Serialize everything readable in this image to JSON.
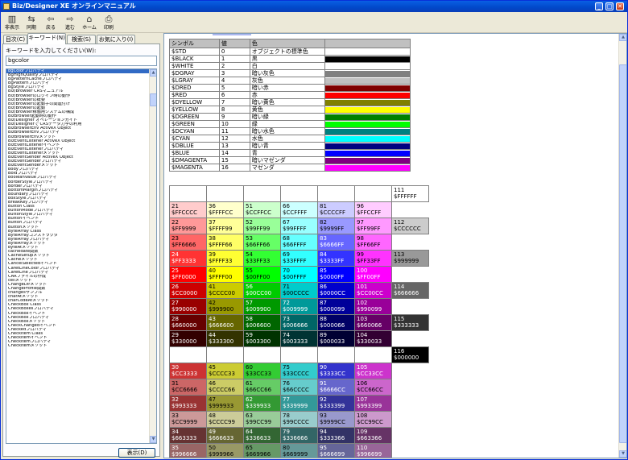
{
  "window": {
    "title": "Biz/Designer XE オンラインマニュアル",
    "min": "_",
    "max": "□",
    "close": "✕"
  },
  "toolbar": [
    {
      "label": "非表示",
      "icon": "hide-icon"
    },
    {
      "label": "同期",
      "icon": "sync-icon"
    },
    {
      "label": "戻る",
      "icon": "back-arrow-icon"
    },
    {
      "label": "進む",
      "icon": "forward-arrow-icon"
    },
    {
      "label": "ホーム",
      "icon": "home-icon"
    },
    {
      "label": "印刷",
      "icon": "print-icon"
    }
  ],
  "tabs": [
    "目次(C)",
    "キーワード(N)",
    "検索(S)",
    "お気に入り(I)"
  ],
  "keyword": {
    "label": "キーワードを入力してください(W):",
    "value": "bgcolor",
    "show_button": "表示(D)"
  },
  "keywords": [
    "bgColorプロパティ",
    "BgHighQualityプロパティ",
    "BgPatternCacheプロパティ",
    "BgPatternプロパティ",
    "BgStyleプロパティ",
    "Biz/Browser CRSマニュアル",
    "Biz/Browserのログイン時の動作",
    "Biz/Browserの概要",
    "Biz/Browserの起動子の関連付け",
    "Biz/Browserの起動",
    "Biz/Browser稼働用システムの構成",
    "BizBrowser起動時の動作",
    "Biz/Designer オペレーションガイド",
    "Biz/Designerで CRSデータ力学の利用",
    "BizBrowserEnv ActiveX Object",
    "BizBrowserEnvプロパティ",
    "BizBrowserEnvメソッド",
    "BizEventListener ActiveX Object",
    "BizEventListenerイベント",
    "BizEventListenerプロパティ",
    "BizEventListenerメソッド",
    "BizEventSender ActiveX Object",
    "BizEventSenderプロパティ",
    "BizEventSenderメソッド",
    "bodyプロパティ",
    "Boldプロパティ",
    "booleanValueプロパティ",
    "borderStyleプロパティ",
    "Borderプロパティ",
    "BottomMarginプロパティ",
    "Boundaryプロパティ",
    "boxStyleプロパティ",
    "BreakKeyプロパティ",
    "Button Class",
    "buttonModeプロパティ",
    "buttonStyleプロパティ",
    "Buttonイベント",
    "Buttonプロパティ",
    "Buttonメソッド",
    "ByteArray Class",
    "ByteArrayコンストラクタ",
    "ByteArrayプロパティ",
    "ByteArrayメソッド",
    "byteAtメソッド",
    "cachedate関数",
    "CacheSetupメソッド",
    "Cacheメソッド",
    "CancelSelectedイベント",
    "CaretLineColorプロパティ",
    "CaretLineプロパティ",
    "CARファイルの作成",
    "ceilメソッド",
    "ChangeDirメソッド",
    "ChangeProfile関数",
    "changesサンプル",
    "charAtメソッド",
    "charCodeAtメソッド",
    "CheckBox Class",
    "CheckBoxesプロパティ",
    "CheckBoxイベント",
    "CheckBoxプロパティ",
    "CheckBoxメソッド",
    "CheckChangedイベント",
    "Checkedプロパティ",
    "CheckItem Class",
    "CheckItemイベント",
    "CheckItemプロパティ",
    "CheckItemメソッド"
  ],
  "colors": {
    "headers": [
      "シンボル",
      "値",
      "色"
    ],
    "rows": [
      {
        "sym": "$STD",
        "val": "0",
        "name": "オブジェクトの標準色",
        "hex": ""
      },
      {
        "sym": "$BLACK",
        "val": "1",
        "name": "黒",
        "hex": "#000000"
      },
      {
        "sym": "$WHITE",
        "val": "2",
        "name": "白",
        "hex": "#ffffff"
      },
      {
        "sym": "$DGRAY",
        "val": "3",
        "name": "暗い灰色",
        "hex": "#808080"
      },
      {
        "sym": "$LGRAY",
        "val": "4",
        "name": "灰色",
        "hex": "#c0c0c0"
      },
      {
        "sym": "$DRED",
        "val": "5",
        "name": "暗い赤",
        "hex": "#800000"
      },
      {
        "sym": "$RED",
        "val": "6",
        "name": "赤",
        "hex": "#ff0000"
      },
      {
        "sym": "$DYELLOW",
        "val": "7",
        "name": "暗い黄色",
        "hex": "#808000"
      },
      {
        "sym": "$YELLOW",
        "val": "8",
        "name": "黄色",
        "hex": "#ffff00"
      },
      {
        "sym": "$DGREEN",
        "val": "9",
        "name": "暗い緑",
        "hex": "#008000"
      },
      {
        "sym": "$GREEN",
        "val": "10",
        "name": "緑",
        "hex": "#00ff00"
      },
      {
        "sym": "$DCYAN",
        "val": "11",
        "name": "暗い水色",
        "hex": "#008080"
      },
      {
        "sym": "$CYAN",
        "val": "12",
        "name": "水色",
        "hex": "#00ffff"
      },
      {
        "sym": "$DBLUE",
        "val": "13",
        "name": "暗い青",
        "hex": "#000080"
      },
      {
        "sym": "$BLUE",
        "val": "14",
        "name": "青",
        "hex": "#0000ff"
      },
      {
        "sym": "$DMAGENTA",
        "val": "15",
        "name": "暗いマゼンダ",
        "hex": "#800080"
      },
      {
        "sym": "$MAGENTA",
        "val": "16",
        "name": "マゼンダ",
        "hex": "#ff00ff"
      }
    ]
  },
  "palette": [
    [
      {
        "n": "",
        "c": "",
        "bg": ""
      },
      {
        "n": "",
        "c": "",
        "bg": ""
      },
      {
        "n": "",
        "c": "",
        "bg": ""
      },
      {
        "n": "",
        "c": "",
        "bg": ""
      },
      {
        "n": "",
        "c": "",
        "bg": ""
      },
      {
        "n": "",
        "c": "",
        "bg": ""
      },
      {
        "n": "111",
        "c": "$FFFFFF",
        "bg": "#ffffff"
      }
    ],
    [
      {
        "n": "21",
        "c": "$FFCCCC",
        "bg": "#ffcccc"
      },
      {
        "n": "36",
        "c": "$FFFFCC",
        "bg": "#ffffcc"
      },
      {
        "n": "51",
        "c": "$CCFFCC",
        "bg": "#ccffcc"
      },
      {
        "n": "66",
        "c": "$CCFFFF",
        "bg": "#ccffff"
      },
      {
        "n": "81",
        "c": "$CCCCFF",
        "bg": "#ccccff"
      },
      {
        "n": "96",
        "c": "$FFCCFF",
        "bg": "#ffccff"
      },
      {
        "n": "",
        "c": "",
        "bg": ""
      }
    ],
    [
      {
        "n": "22",
        "c": "$FF9999",
        "bg": "#ff9999"
      },
      {
        "n": "37",
        "c": "$FFFF99",
        "bg": "#ffff99"
      },
      {
        "n": "52",
        "c": "$99FF99",
        "bg": "#99ff99"
      },
      {
        "n": "67",
        "c": "$99FFFF",
        "bg": "#99ffff"
      },
      {
        "n": "82",
        "c": "$9999FF",
        "bg": "#9999ff"
      },
      {
        "n": "97",
        "c": "$FF99FF",
        "bg": "#ff99ff"
      },
      {
        "n": "112",
        "c": "$CCCCCC",
        "bg": "#cccccc"
      }
    ],
    [
      {
        "n": "23",
        "c": "$FF6666",
        "bg": "#ff6666"
      },
      {
        "n": "38",
        "c": "$FFFF66",
        "bg": "#ffff66"
      },
      {
        "n": "53",
        "c": "$66FF66",
        "bg": "#66ff66"
      },
      {
        "n": "68",
        "c": "$66FFFF",
        "bg": "#66ffff"
      },
      {
        "n": "83",
        "c": "$6666FF",
        "bg": "#6666ff"
      },
      {
        "n": "98",
        "c": "$FF66FF",
        "bg": "#ff66ff"
      },
      {
        "n": "",
        "c": "",
        "bg": ""
      }
    ],
    [
      {
        "n": "24",
        "c": "$FF3333",
        "bg": "#ff3333"
      },
      {
        "n": "39",
        "c": "$FFFF33",
        "bg": "#ffff33"
      },
      {
        "n": "54",
        "c": "$33FF33",
        "bg": "#33ff33"
      },
      {
        "n": "69",
        "c": "$33FFFF",
        "bg": "#33ffff"
      },
      {
        "n": "84",
        "c": "$3333FF",
        "bg": "#3333ff"
      },
      {
        "n": "99",
        "c": "$FF33FF",
        "bg": "#ff33ff"
      },
      {
        "n": "113",
        "c": "$999999",
        "bg": "#999999"
      }
    ],
    [
      {
        "n": "25",
        "c": "$FF0000",
        "bg": "#ff0000"
      },
      {
        "n": "40",
        "c": "$FFFF00",
        "bg": "#ffff00"
      },
      {
        "n": "55",
        "c": "$00FF00",
        "bg": "#00ff00"
      },
      {
        "n": "70",
        "c": "$00FFFF",
        "bg": "#00ffff"
      },
      {
        "n": "85",
        "c": "$0000FF",
        "bg": "#0000ff"
      },
      {
        "n": "100",
        "c": "$FF00FF",
        "bg": "#ff00ff"
      },
      {
        "n": "",
        "c": "",
        "bg": ""
      }
    ],
    [
      {
        "n": "26",
        "c": "$CC0000",
        "bg": "#cc0000"
      },
      {
        "n": "41",
        "c": "$CCCC00",
        "bg": "#cccc00"
      },
      {
        "n": "56",
        "c": "$00CC00",
        "bg": "#00cc00"
      },
      {
        "n": "71",
        "c": "$00CCCC",
        "bg": "#00cccc"
      },
      {
        "n": "86",
        "c": "$0000CC",
        "bg": "#0000cc"
      },
      {
        "n": "101",
        "c": "$CC00CC",
        "bg": "#cc00cc"
      },
      {
        "n": "114",
        "c": "$666666",
        "bg": "#666666"
      }
    ],
    [
      {
        "n": "27",
        "c": "$990000",
        "bg": "#990000"
      },
      {
        "n": "42",
        "c": "$999900",
        "bg": "#999900"
      },
      {
        "n": "57",
        "c": "$009900",
        "bg": "#009900"
      },
      {
        "n": "72",
        "c": "$009999",
        "bg": "#009999"
      },
      {
        "n": "87",
        "c": "$000099",
        "bg": "#000099"
      },
      {
        "n": "102",
        "c": "$990099",
        "bg": "#990099"
      },
      {
        "n": "",
        "c": "",
        "bg": ""
      }
    ],
    [
      {
        "n": "28",
        "c": "$660000",
        "bg": "#660000"
      },
      {
        "n": "43",
        "c": "$666600",
        "bg": "#666600"
      },
      {
        "n": "58",
        "c": "$006600",
        "bg": "#006600"
      },
      {
        "n": "73",
        "c": "$006666",
        "bg": "#006666"
      },
      {
        "n": "88",
        "c": "$000066",
        "bg": "#000066"
      },
      {
        "n": "103",
        "c": "$660066",
        "bg": "#660066"
      },
      {
        "n": "115",
        "c": "$333333",
        "bg": "#333333"
      }
    ],
    [
      {
        "n": "29",
        "c": "$330000",
        "bg": "#330000"
      },
      {
        "n": "44",
        "c": "$333300",
        "bg": "#333300"
      },
      {
        "n": "59",
        "c": "$003300",
        "bg": "#003300"
      },
      {
        "n": "74",
        "c": "$003333",
        "bg": "#003333"
      },
      {
        "n": "89",
        "c": "$000033",
        "bg": "#000033"
      },
      {
        "n": "104",
        "c": "$330033",
        "bg": "#330033"
      },
      {
        "n": "",
        "c": "",
        "bg": ""
      }
    ],
    [
      {
        "n": "",
        "c": "",
        "bg": ""
      },
      {
        "n": "",
        "c": "",
        "bg": ""
      },
      {
        "n": "",
        "c": "",
        "bg": ""
      },
      {
        "n": "",
        "c": "",
        "bg": ""
      },
      {
        "n": "",
        "c": "",
        "bg": ""
      },
      {
        "n": "",
        "c": "",
        "bg": ""
      },
      {
        "n": "116",
        "c": "$000000",
        "bg": "#000000"
      }
    ],
    [
      {
        "n": "30",
        "c": "$CC3333",
        "bg": "#cc3333"
      },
      {
        "n": "45",
        "c": "$CCCC33",
        "bg": "#cccc33"
      },
      {
        "n": "60",
        "c": "$33CC33",
        "bg": "#33cc33"
      },
      {
        "n": "75",
        "c": "$33CCCC",
        "bg": "#33cccc"
      },
      {
        "n": "90",
        "c": "$3333CC",
        "bg": "#3333cc"
      },
      {
        "n": "105",
        "c": "$CC33CC",
        "bg": "#cc33cc"
      },
      {
        "n": "",
        "c": "",
        "bg": ""
      }
    ],
    [
      {
        "n": "31",
        "c": "$CC6666",
        "bg": "#cc6666"
      },
      {
        "n": "46",
        "c": "$CCCC66",
        "bg": "#cccc66"
      },
      {
        "n": "61",
        "c": "$66CC66",
        "bg": "#66cc66"
      },
      {
        "n": "76",
        "c": "$66CCCC",
        "bg": "#66cccc"
      },
      {
        "n": "91",
        "c": "$6666CC",
        "bg": "#6666cc"
      },
      {
        "n": "106",
        "c": "$CC66CC",
        "bg": "#cc66cc"
      },
      {
        "n": "",
        "c": "",
        "bg": ""
      }
    ],
    [
      {
        "n": "32",
        "c": "$993333",
        "bg": "#993333"
      },
      {
        "n": "47",
        "c": "$999933",
        "bg": "#999933"
      },
      {
        "n": "62",
        "c": "$339933",
        "bg": "#339933"
      },
      {
        "n": "77",
        "c": "$339999",
        "bg": "#339999"
      },
      {
        "n": "92",
        "c": "$333399",
        "bg": "#333399"
      },
      {
        "n": "107",
        "c": "$993399",
        "bg": "#993399"
      },
      {
        "n": "",
        "c": "",
        "bg": ""
      }
    ],
    [
      {
        "n": "33",
        "c": "$CC9999",
        "bg": "#cc9999"
      },
      {
        "n": "48",
        "c": "$CCCC99",
        "bg": "#cccc99"
      },
      {
        "n": "63",
        "c": "$99CC99",
        "bg": "#99cc99"
      },
      {
        "n": "78",
        "c": "$99CCCC",
        "bg": "#99cccc"
      },
      {
        "n": "93",
        "c": "$9999CC",
        "bg": "#9999cc"
      },
      {
        "n": "108",
        "c": "$CC99CC",
        "bg": "#cc99cc"
      },
      {
        "n": "",
        "c": "",
        "bg": ""
      }
    ],
    [
      {
        "n": "34",
        "c": "$663333",
        "bg": "#663333"
      },
      {
        "n": "49",
        "c": "$666633",
        "bg": "#666633"
      },
      {
        "n": "64",
        "c": "$336633",
        "bg": "#336633"
      },
      {
        "n": "79",
        "c": "$336666",
        "bg": "#336666"
      },
      {
        "n": "94",
        "c": "$333366",
        "bg": "#333366"
      },
      {
        "n": "109",
        "c": "$663366",
        "bg": "#663366"
      },
      {
        "n": "",
        "c": "",
        "bg": ""
      }
    ],
    [
      {
        "n": "35",
        "c": "$996666",
        "bg": "#996666"
      },
      {
        "n": "50",
        "c": "$999966",
        "bg": "#999966"
      },
      {
        "n": "65",
        "c": "$669966",
        "bg": "#669966"
      },
      {
        "n": "80",
        "c": "$669999",
        "bg": "#669999"
      },
      {
        "n": "95",
        "c": "$666699",
        "bg": "#666699"
      },
      {
        "n": "110",
        "c": "$996699",
        "bg": "#996699"
      },
      {
        "n": "",
        "c": "",
        "bg": ""
      }
    ]
  ]
}
